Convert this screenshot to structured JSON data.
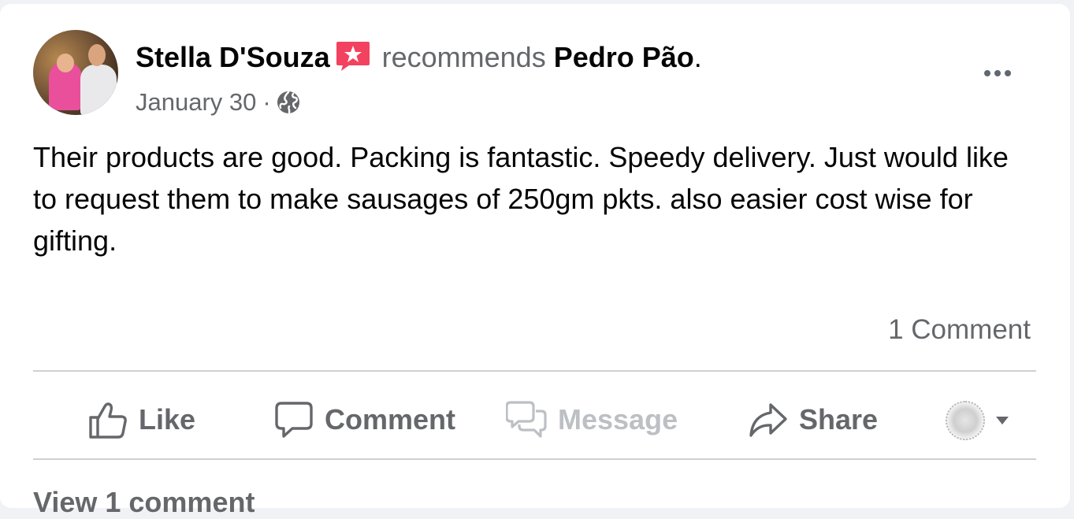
{
  "post": {
    "author": "Stella D'Souza",
    "verb": "recommends",
    "page_name": "Pedro Pão",
    "date": "January 30",
    "separator": "·",
    "audience_icon": "globe-icon",
    "badge_icon": "recommend-star-icon",
    "text": "Their products are good. Packing is fantastic. Speedy delivery. Just would like to request them to make sausages of 250gm pkts. also easier cost wise for gifting.",
    "comments_count": "1 Comment"
  },
  "actions": {
    "like": "Like",
    "comment": "Comment",
    "message": "Message",
    "share": "Share"
  },
  "footer": {
    "view_comments": "View 1 comment"
  },
  "colors": {
    "badge": "#f3425f",
    "secondary_text": "#65676b",
    "disabled_text": "#bcc0c4"
  }
}
